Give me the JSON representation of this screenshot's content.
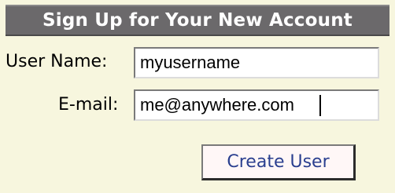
{
  "form": {
    "title": "Sign Up for Your New Account",
    "username_label": "User Name:",
    "username_value": "myusername",
    "email_label": "E-mail:",
    "email_value": "me@anywhere.com",
    "submit_label": "Create User"
  },
  "colors": {
    "panel_background": "#f7f6de",
    "header_background": "#6b696b",
    "header_text": "#ffffff",
    "button_text": "#2a3f8f",
    "button_background": "#fff7f7"
  }
}
